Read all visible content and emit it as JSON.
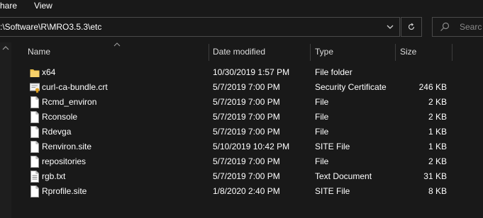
{
  "menu": {
    "share_label": "hare",
    "view_label": "View"
  },
  "address": {
    "path": ":\\Software\\R\\MRO3.5.3\\etc"
  },
  "search": {
    "placeholder": "Searc"
  },
  "columns": {
    "name": "Name",
    "date": "Date modified",
    "type": "Type",
    "size": "Size"
  },
  "colors": {
    "background": "#191919",
    "text": "#ffffff",
    "folder": "#f0c34a",
    "border": "#4a4a4a"
  },
  "files": [
    {
      "name": "x64",
      "date": "10/30/2019 1:57 PM",
      "type": "File folder",
      "size": "",
      "icon": "folder-icon"
    },
    {
      "name": "curl-ca-bundle.crt",
      "date": "5/7/2019 7:00 PM",
      "type": "Security Certificate",
      "size": "246 KB",
      "icon": "certificate-icon"
    },
    {
      "name": "Rcmd_environ",
      "date": "5/7/2019 7:00 PM",
      "type": "File",
      "size": "2 KB",
      "icon": "file-icon"
    },
    {
      "name": "Rconsole",
      "date": "5/7/2019 7:00 PM",
      "type": "File",
      "size": "2 KB",
      "icon": "file-icon"
    },
    {
      "name": "Rdevga",
      "date": "5/7/2019 7:00 PM",
      "type": "File",
      "size": "1 KB",
      "icon": "file-icon"
    },
    {
      "name": "Renviron.site",
      "date": "5/10/2019 10:42 PM",
      "type": "SITE File",
      "size": "1 KB",
      "icon": "file-icon"
    },
    {
      "name": "repositories",
      "date": "5/7/2019 7:00 PM",
      "type": "File",
      "size": "2 KB",
      "icon": "file-icon"
    },
    {
      "name": "rgb.txt",
      "date": "5/7/2019 7:00 PM",
      "type": "Text Document",
      "size": "31 KB",
      "icon": "text-file-icon"
    },
    {
      "name": "Rprofile.site",
      "date": "1/8/2020 2:40 PM",
      "type": "SITE File",
      "size": "8 KB",
      "icon": "file-icon"
    }
  ]
}
